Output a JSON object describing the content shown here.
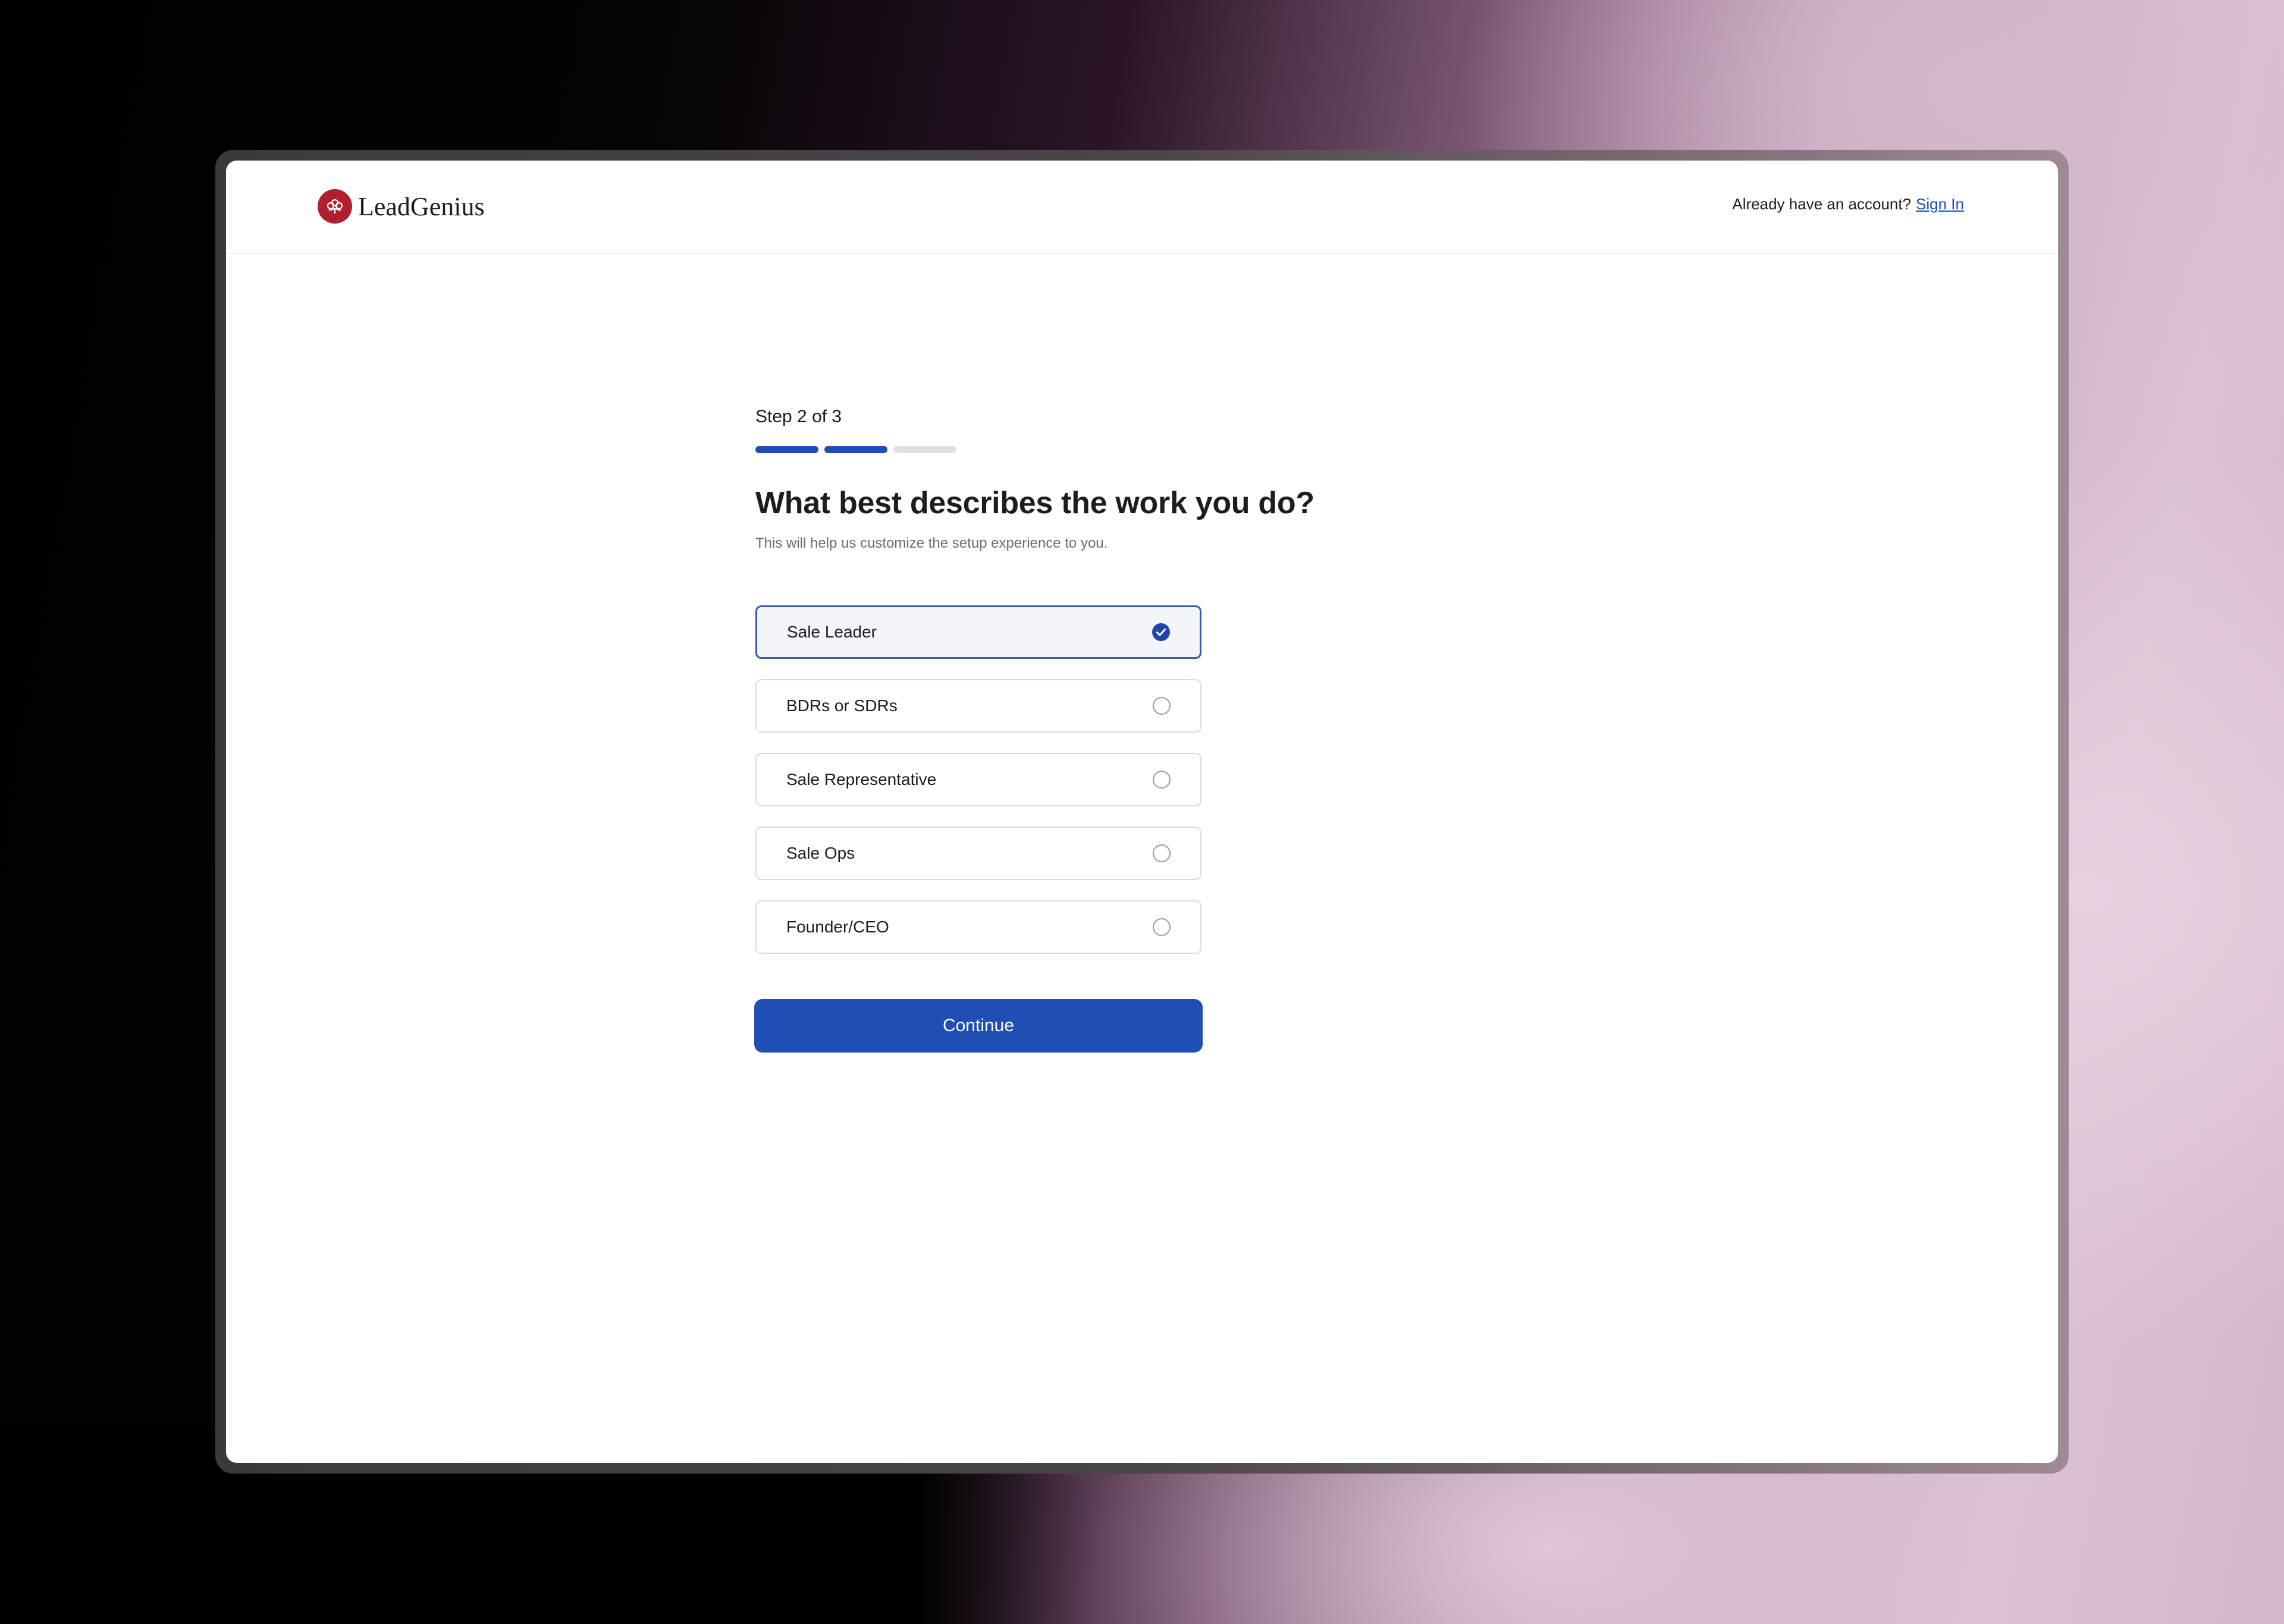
{
  "brand": {
    "name": "LeadGenius",
    "logo_icon": "leadgenius-logo-icon",
    "logo_color": "#b01f2e"
  },
  "header": {
    "signin_prompt": "Already have an account?",
    "signin_link": "Sign In"
  },
  "step": {
    "label": "Step 2 of 3",
    "current": 2,
    "total": 3
  },
  "form": {
    "question": "What best describes the work you do?",
    "helper": "This will help us customize the setup experience to you.",
    "options": [
      {
        "label": "Sale Leader",
        "selected": true
      },
      {
        "label": "BDRs or SDRs",
        "selected": false
      },
      {
        "label": "Sale Representative",
        "selected": false
      },
      {
        "label": "Sale Ops",
        "selected": false
      },
      {
        "label": "Founder/CEO",
        "selected": false
      }
    ],
    "continue_label": "Continue"
  },
  "colors": {
    "accent": "#1f4fb5",
    "selected_border": "#3a5ea8",
    "progress_inactive": "#e1e1e5"
  }
}
